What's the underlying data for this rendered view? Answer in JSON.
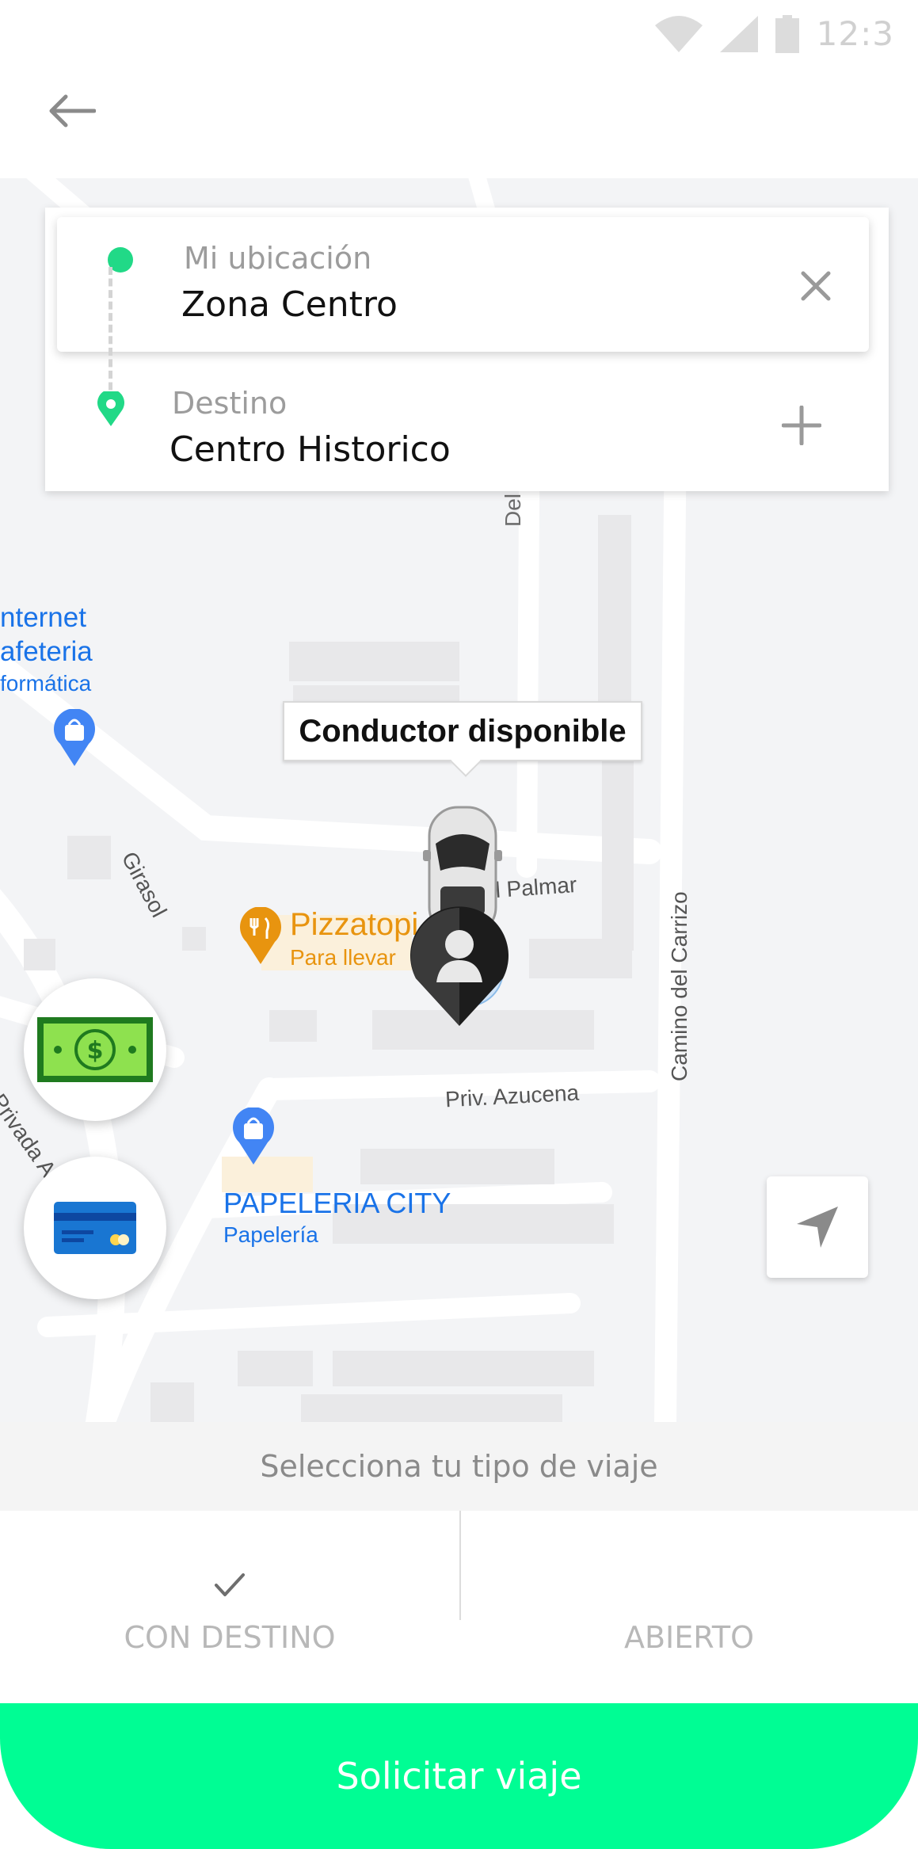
{
  "status_bar": {
    "time": "12:3",
    "icons": [
      "wifi-icon",
      "signal-icon",
      "battery-icon"
    ]
  },
  "header": {
    "back_icon": "arrow-left-icon"
  },
  "route": {
    "origin_label": "Mi ubicación",
    "origin_value": "Zona Centro",
    "destination_label": "Destino",
    "destination_value": "Centro Historico",
    "clear_icon": "close-icon",
    "add_icon": "plus-icon"
  },
  "map": {
    "tooltip": "Conductor disponible",
    "places": {
      "internet_name_1": "nternet",
      "internet_name_2": "afeteria",
      "internet_cat": "formática",
      "pizza_name": "Pizzatopi",
      "pizza_cat": "Para llevar",
      "papeleria_name": "PAPELERIA CITY",
      "papeleria_cat": "Papelería"
    },
    "streets": {
      "del_ja": "Del Ja",
      "el_palmar": "el Palmar",
      "girasol": "Girasol",
      "camino": "Camino del Carrizo",
      "azucena": "Priv. Azucena",
      "privada": "Privada A"
    }
  },
  "payment": {
    "cash_icon": "cash-icon",
    "card_icon": "credit-card-icon"
  },
  "locate_icon": "navigation-arrow-icon",
  "trip_type": {
    "title": "Selecciona tu tipo de viaje",
    "tabs": [
      {
        "label": "CON DESTINO",
        "selected": true
      },
      {
        "label": "ABIERTO",
        "selected": false
      }
    ],
    "check_icon": "checkmark-icon"
  },
  "cta": {
    "label": "Solicitar viaje"
  },
  "colors": {
    "accent": "#00fd94",
    "marker": "#21d987",
    "place_blue": "#1a73e8",
    "place_orange": "#e8940f"
  }
}
